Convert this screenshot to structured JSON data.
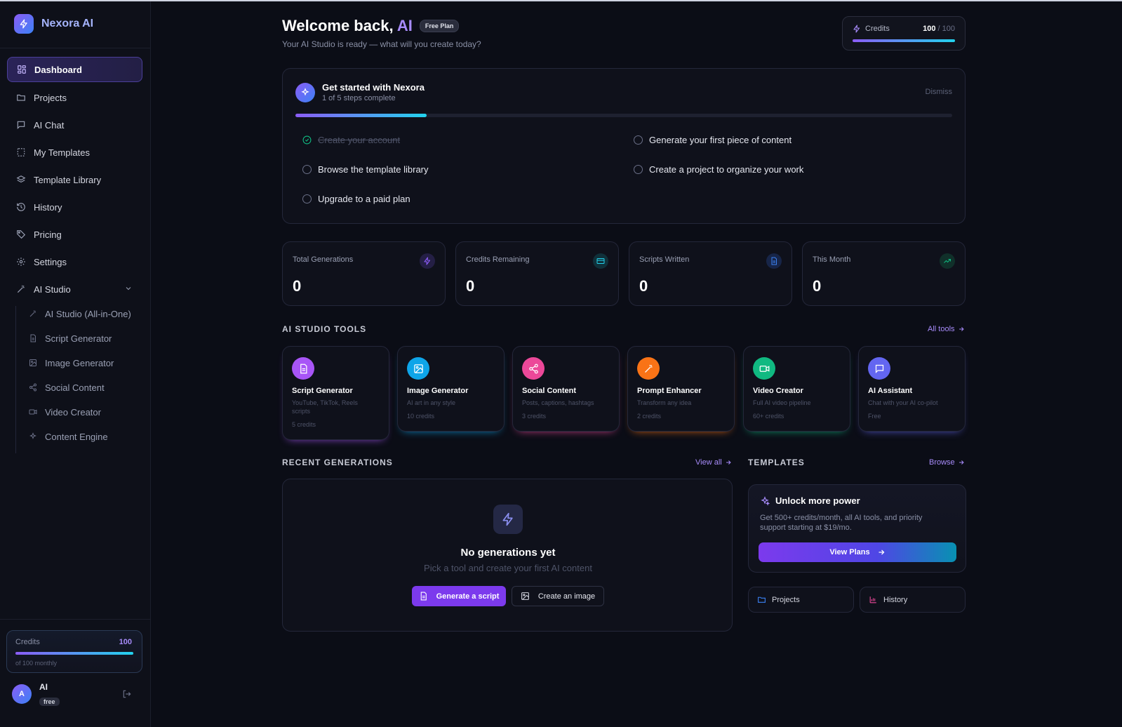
{
  "app": {
    "name": "Nexora AI"
  },
  "sidebar": {
    "items": [
      {
        "label": "Dashboard",
        "icon": "grid-icon",
        "active": true
      },
      {
        "label": "Projects",
        "icon": "folder-icon"
      },
      {
        "label": "AI Chat",
        "icon": "chat-icon"
      },
      {
        "label": "My Templates",
        "icon": "template-icon"
      },
      {
        "label": "Template Library",
        "icon": "layers-icon"
      },
      {
        "label": "History",
        "icon": "history-icon"
      },
      {
        "label": "Pricing",
        "icon": "tag-icon"
      },
      {
        "label": "Settings",
        "icon": "gear-icon"
      },
      {
        "label": "AI Studio",
        "icon": "wand-icon",
        "expanded": true
      }
    ],
    "studio_items": [
      {
        "label": "AI Studio (All-in-One)",
        "icon": "wand-icon"
      },
      {
        "label": "Script Generator",
        "icon": "document-icon"
      },
      {
        "label": "Image Generator",
        "icon": "image-icon"
      },
      {
        "label": "Social Content",
        "icon": "share-icon"
      },
      {
        "label": "Video Creator",
        "icon": "video-icon"
      },
      {
        "label": "Content Engine",
        "icon": "sparkles-icon"
      }
    ],
    "credits": {
      "label": "Credits",
      "value": "100",
      "sub": "of 100 monthly",
      "fraction": 1.0
    },
    "user": {
      "initial": "A",
      "name": "AI",
      "plan": "free"
    }
  },
  "header": {
    "greeting": "Welcome back,",
    "user_name": "AI",
    "plan_badge": "Free Plan",
    "subtitle": "Your AI Studio is ready — what will you create today?",
    "credits": {
      "label": "Credits",
      "used": "100",
      "total": "/ 100",
      "fraction": 1.0
    }
  },
  "onboarding": {
    "title": "Get started with Nexora",
    "progress_text": "1 of 5 steps complete",
    "dismiss": "Dismiss",
    "progress_fraction": 0.2,
    "tasks": [
      {
        "label": "Create your account",
        "done": true
      },
      {
        "label": "Generate your first piece of content",
        "done": false
      },
      {
        "label": "Browse the template library",
        "done": false
      },
      {
        "label": "Create a project to organize your work",
        "done": false
      },
      {
        "label": "Upgrade to a paid plan",
        "done": false
      }
    ]
  },
  "stats": [
    {
      "label": "Total Generations",
      "value": "0",
      "icon": "bolt-icon",
      "color": "#8b5cf6"
    },
    {
      "label": "Credits Remaining",
      "value": "0",
      "icon": "card-icon",
      "color": "#22d3ee"
    },
    {
      "label": "Scripts Written",
      "value": "0",
      "icon": "document-icon",
      "color": "#3b82f6"
    },
    {
      "label": "This Month",
      "value": "0",
      "icon": "trend-up-icon",
      "color": "#10b981"
    }
  ],
  "tools_section": {
    "title": "AI STUDIO TOOLS",
    "link": "All tools"
  },
  "tools": [
    {
      "name": "Script Generator",
      "desc": "YouTube, TikTok, Reels scripts",
      "cost": "5 credits",
      "icon": "document-icon",
      "color": "#a855f7"
    },
    {
      "name": "Image Generator",
      "desc": "AI art in any style",
      "cost": "10 credits",
      "icon": "image-icon",
      "color": "#0ea5e9"
    },
    {
      "name": "Social Content",
      "desc": "Posts, captions, hashtags",
      "cost": "3 credits",
      "icon": "share-icon",
      "color": "#ec4899"
    },
    {
      "name": "Prompt Enhancer",
      "desc": "Transform any idea",
      "cost": "2 credits",
      "icon": "wand-icon",
      "color": "#f97316"
    },
    {
      "name": "Video Creator",
      "desc": "Full AI video pipeline",
      "cost": "60+ credits",
      "icon": "video-icon",
      "color": "#10b981"
    },
    {
      "name": "AI Assistant",
      "desc": "Chat with your AI co-pilot",
      "cost": "Free",
      "icon": "chat-icon",
      "color": "#6366f1"
    }
  ],
  "recent": {
    "title": "RECENT GENERATIONS",
    "link": "View all",
    "empty_title": "No generations yet",
    "empty_sub": "Pick a tool and create your first AI content",
    "primary_button": "Generate a script",
    "secondary_button": "Create an image"
  },
  "templates": {
    "title": "TEMPLATES",
    "link": "Browse",
    "promo_title": "Unlock more power",
    "promo_desc": "Get 500+ credits/month, all AI tools, and priority support starting at $19/mo.",
    "promo_button": "View Plans",
    "quick_links": [
      {
        "label": "Projects",
        "icon": "folder-icon"
      },
      {
        "label": "History",
        "icon": "bar-chart-icon"
      }
    ]
  }
}
